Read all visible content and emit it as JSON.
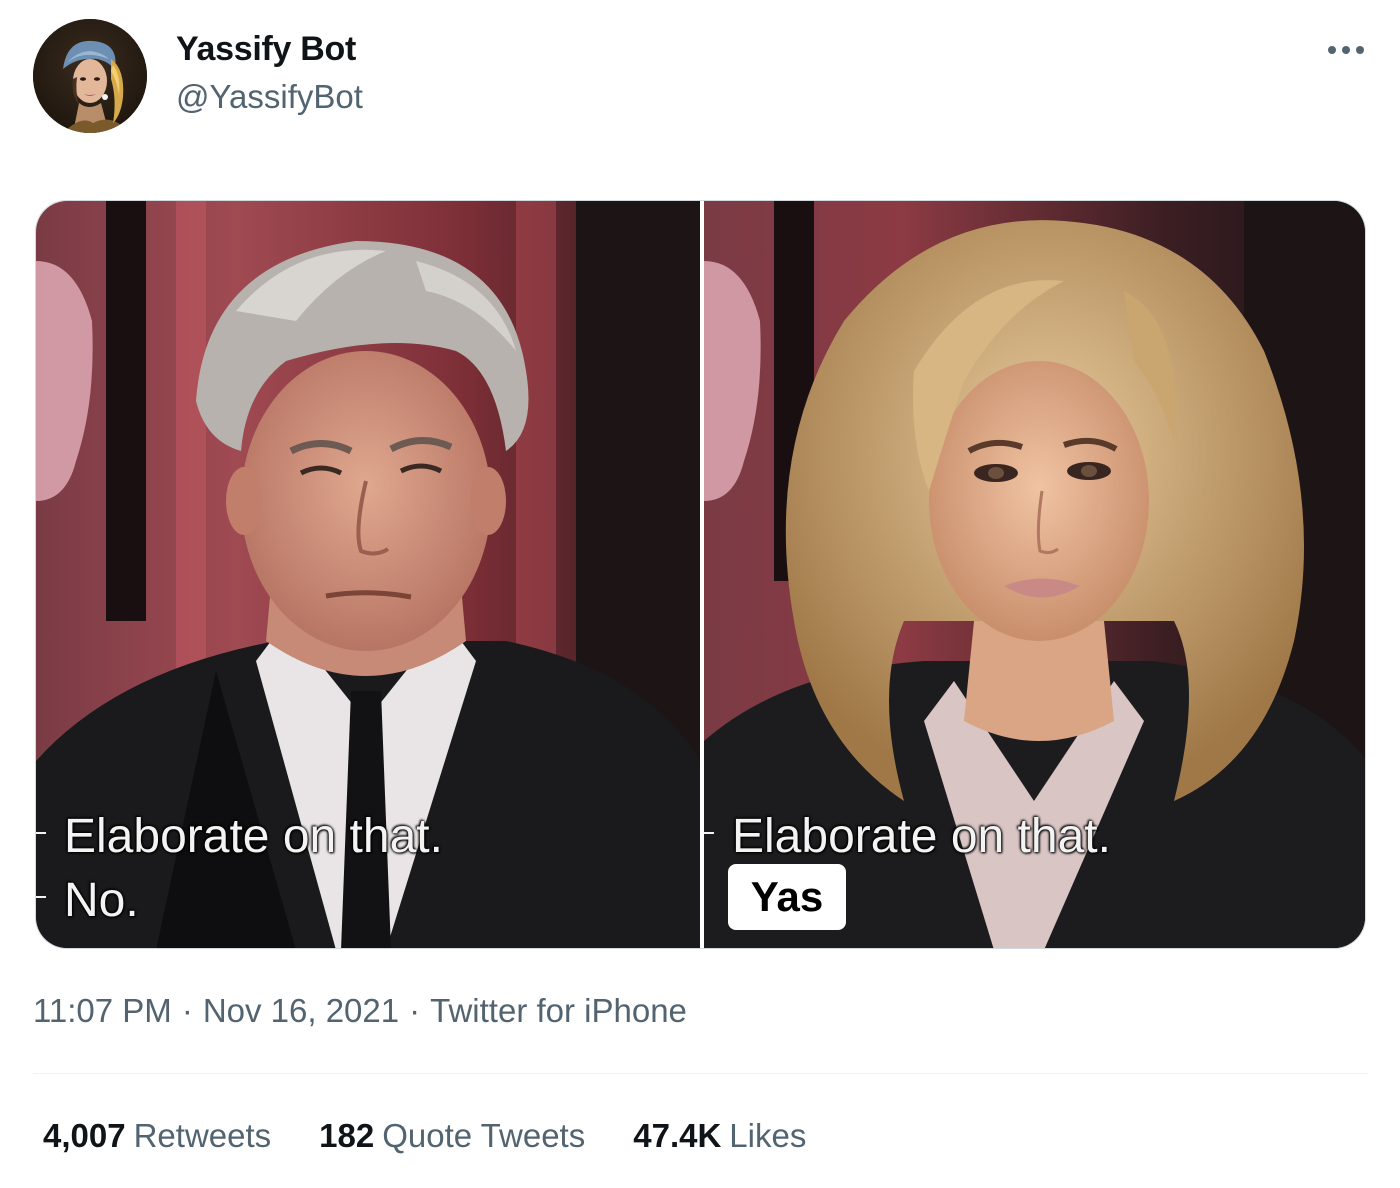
{
  "author": {
    "display_name": "Yassify Bot",
    "handle": "@YassifyBot",
    "avatar_icon": "avatar-girl-with-pearl-earring"
  },
  "more_icon": "more-horizontal-icon",
  "media": {
    "left": {
      "caption_line1": "Elaborate on that.",
      "caption_line2": "No."
    },
    "right": {
      "caption_line1": "Elaborate on that.",
      "caption_line2": "Yas"
    }
  },
  "meta": {
    "time": "11:07 PM",
    "separator": "·",
    "date": "Nov 16, 2021",
    "source": "Twitter for iPhone"
  },
  "stats": {
    "retweets_count": "4,007",
    "retweets_label": "Retweets",
    "quotes_count": "182",
    "quotes_label": "Quote Tweets",
    "likes_count": "47.4K",
    "likes_label": "Likes"
  },
  "colors": {
    "text_primary": "#0f1419",
    "text_secondary": "#536471",
    "border": "#cfd9de",
    "divider": "#eff3f4"
  }
}
